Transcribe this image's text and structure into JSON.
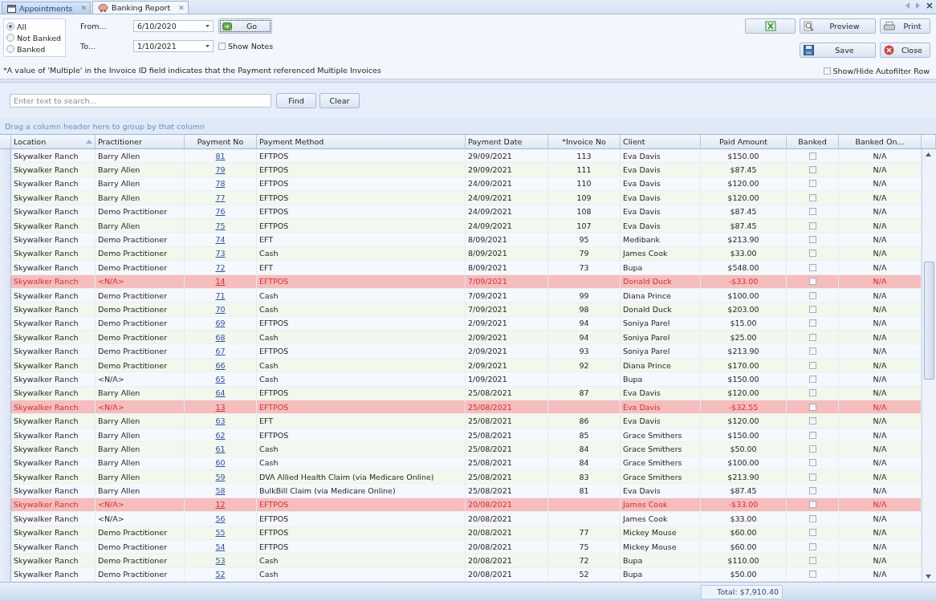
{
  "tabs": [
    {
      "label": "Appointments",
      "selected": false,
      "close": "✕"
    },
    {
      "label": "Banking Report",
      "selected": true,
      "close": "✕"
    }
  ],
  "filter": {
    "options": [
      {
        "label": "All",
        "selected": true
      },
      {
        "label": "Not Banked",
        "selected": false
      },
      {
        "label": "Banked",
        "selected": false
      }
    ],
    "from_label": "From...",
    "from_value": "6/10/2020",
    "to_label": "To...",
    "to_value": "1/10/2021",
    "go_button": "Go",
    "show_notes": {
      "label": "Show Notes",
      "checked": false
    },
    "note": "*A value of 'Multiple' in the Invoice ID field indicates that the Payment referenced Multiple Invoices"
  },
  "actions": {
    "preview": "Preview",
    "print": "Print",
    "save": "Save",
    "close": "Close",
    "autofilter": {
      "label": "Show/Hide Autofilter Row",
      "checked": false
    }
  },
  "search": {
    "placeholder": "Enter text to search...",
    "find": "Find",
    "clear": "Clear"
  },
  "group_hint": "Drag a column header here to group by that column",
  "table": {
    "columns": [
      "Location",
      "Practitioner",
      "Payment No",
      "Payment Method",
      "Payment Date",
      "*Invoice No",
      "Client",
      "Paid Amount",
      "Banked",
      "Banked On..."
    ],
    "rows": [
      {
        "location": "Skywalker Ranch",
        "practitioner": "Barry Allen",
        "payment_no": "81",
        "method": "EFTPOS",
        "date": "29/09/2021",
        "invoice": "113",
        "client": "Eva Davis",
        "amount": "$150.00",
        "banked": false,
        "banked_on": "N/A",
        "flagged": false
      },
      {
        "location": "Skywalker Ranch",
        "practitioner": "Barry Allen",
        "payment_no": "79",
        "method": "EFTPOS",
        "date": "29/09/2021",
        "invoice": "111",
        "client": "Eva Davis",
        "amount": "$87.45",
        "banked": false,
        "banked_on": "N/A",
        "flagged": false
      },
      {
        "location": "Skywalker Ranch",
        "practitioner": "Barry Allen",
        "payment_no": "78",
        "method": "EFTPOS",
        "date": "24/09/2021",
        "invoice": "110",
        "client": "Eva Davis",
        "amount": "$120.00",
        "banked": false,
        "banked_on": "N/A",
        "flagged": false
      },
      {
        "location": "Skywalker Ranch",
        "practitioner": "Barry Allen",
        "payment_no": "77",
        "method": "EFTPOS",
        "date": "24/09/2021",
        "invoice": "109",
        "client": "Eva Davis",
        "amount": "$120.00",
        "banked": false,
        "banked_on": "N/A",
        "flagged": false
      },
      {
        "location": "Skywalker Ranch",
        "practitioner": "Demo Practitioner",
        "payment_no": "76",
        "method": "EFTPOS",
        "date": "24/09/2021",
        "invoice": "108",
        "client": "Eva Davis",
        "amount": "$87.45",
        "banked": false,
        "banked_on": "N/A",
        "flagged": false
      },
      {
        "location": "Skywalker Ranch",
        "practitioner": "Barry Allen",
        "payment_no": "75",
        "method": "EFTPOS",
        "date": "24/09/2021",
        "invoice": "107",
        "client": "Eva Davis",
        "amount": "$87.45",
        "banked": false,
        "banked_on": "N/A",
        "flagged": false
      },
      {
        "location": "Skywalker Ranch",
        "practitioner": "Demo Practitioner",
        "payment_no": "74",
        "method": "EFT",
        "date": "8/09/2021",
        "invoice": "95",
        "client": "Medibank",
        "amount": "$213.90",
        "banked": false,
        "banked_on": "N/A",
        "flagged": false
      },
      {
        "location": "Skywalker Ranch",
        "practitioner": "Demo Practitioner",
        "payment_no": "73",
        "method": "Cash",
        "date": "8/09/2021",
        "invoice": "79",
        "client": "James Cook",
        "amount": "$33.00",
        "banked": false,
        "banked_on": "N/A",
        "flagged": false
      },
      {
        "location": "Skywalker Ranch",
        "practitioner": "Demo Practitioner",
        "payment_no": "72",
        "method": "EFT",
        "date": "8/09/2021",
        "invoice": "73",
        "client": "Bupa",
        "amount": "$548.00",
        "banked": false,
        "banked_on": "N/A",
        "flagged": false
      },
      {
        "location": "Skywalker Ranch",
        "practitioner": "<N/A>",
        "payment_no": "14",
        "method": "EFTPOS",
        "date": "7/09/2021",
        "client": "Donald Duck",
        "amount": "-$33.00",
        "banked": false,
        "banked_on": "N/A",
        "flagged": true
      },
      {
        "location": "Skywalker Ranch",
        "practitioner": "Demo Practitioner",
        "payment_no": "71",
        "method": "Cash",
        "date": "7/09/2021",
        "invoice": "99",
        "client": "Diana Prince",
        "amount": "$100.00",
        "banked": false,
        "banked_on": "N/A",
        "flagged": false
      },
      {
        "location": "Skywalker Ranch",
        "practitioner": "Demo Practitioner",
        "payment_no": "70",
        "method": "Cash",
        "date": "7/09/2021",
        "invoice": "98",
        "client": "Donald Duck",
        "amount": "$203.00",
        "banked": false,
        "banked_on": "N/A",
        "flagged": false
      },
      {
        "location": "Skywalker Ranch",
        "practitioner": "Demo Practitioner",
        "payment_no": "69",
        "method": "EFTPOS",
        "date": "2/09/2021",
        "invoice": "94",
        "client": "Soniya Parel",
        "amount": "$15.00",
        "banked": false,
        "banked_on": "N/A",
        "flagged": false
      },
      {
        "location": "Skywalker Ranch",
        "practitioner": "Demo Practitioner",
        "payment_no": "68",
        "method": "Cash",
        "date": "2/09/2021",
        "invoice": "94",
        "client": "Soniya Parel",
        "amount": "$25.00",
        "banked": false,
        "banked_on": "N/A",
        "flagged": false
      },
      {
        "location": "Skywalker Ranch",
        "practitioner": "Demo Practitioner",
        "payment_no": "67",
        "method": "EFTPOS",
        "date": "2/09/2021",
        "invoice": "93",
        "client": "Soniya Parel",
        "amount": "$213.90",
        "banked": false,
        "banked_on": "N/A",
        "flagged": false
      },
      {
        "location": "Skywalker Ranch",
        "practitioner": "Demo Practitioner",
        "payment_no": "66",
        "method": "Cash",
        "date": "2/09/2021",
        "invoice": "92",
        "client": "Diana Prince",
        "amount": "$170.00",
        "banked": false,
        "banked_on": "N/A",
        "flagged": false
      },
      {
        "location": "Skywalker Ranch",
        "practitioner": "<N/A>",
        "payment_no": "65",
        "method": "Cash",
        "date": "1/09/2021",
        "client": "Bupa",
        "amount": "$150.00",
        "banked": false,
        "banked_on": "N/A",
        "flagged": false
      },
      {
        "location": "Skywalker Ranch",
        "practitioner": "Barry Allen",
        "payment_no": "64",
        "method": "EFTPOS",
        "date": "25/08/2021",
        "invoice": "87",
        "client": "Eva Davis",
        "amount": "$120.00",
        "banked": false,
        "banked_on": "N/A",
        "flagged": false
      },
      {
        "location": "Skywalker Ranch",
        "practitioner": "<N/A>",
        "payment_no": "13",
        "method": "EFTPOS",
        "date": "25/08/2021",
        "client": "Eva Davis",
        "amount": "-$32.55",
        "banked": false,
        "banked_on": "N/A",
        "flagged": true
      },
      {
        "location": "Skywalker Ranch",
        "practitioner": "Barry Allen",
        "payment_no": "63",
        "method": "EFT",
        "date": "25/08/2021",
        "invoice": "86",
        "client": "Eva Davis",
        "amount": "$120.00",
        "banked": false,
        "banked_on": "N/A",
        "flagged": false
      },
      {
        "location": "Skywalker Ranch",
        "practitioner": "Barry Allen",
        "payment_no": "62",
        "method": "EFTPOS",
        "date": "25/08/2021",
        "invoice": "85",
        "client": "Grace Smithers",
        "amount": "$150.00",
        "banked": false,
        "banked_on": "N/A",
        "flagged": false
      },
      {
        "location": "Skywalker Ranch",
        "practitioner": "Barry Allen",
        "payment_no": "61",
        "method": "Cash",
        "date": "25/08/2021",
        "invoice": "84",
        "client": "Grace Smithers",
        "amount": "$50.00",
        "banked": false,
        "banked_on": "N/A",
        "flagged": false
      },
      {
        "location": "Skywalker Ranch",
        "practitioner": "Barry Allen",
        "payment_no": "60",
        "method": "Cash",
        "date": "25/08/2021",
        "invoice": "84",
        "client": "Grace Smithers",
        "amount": "$100.00",
        "banked": false,
        "banked_on": "N/A",
        "flagged": false
      },
      {
        "location": "Skywalker Ranch",
        "practitioner": "Barry Allen",
        "payment_no": "59",
        "method": "DVA Allied Health Claim (via Medicare Online)",
        "date": "25/08/2021",
        "invoice": "83",
        "client": "Grace Smithers",
        "amount": "$213.90",
        "banked": false,
        "banked_on": "N/A",
        "flagged": false
      },
      {
        "location": "Skywalker Ranch",
        "practitioner": "Barry Allen",
        "payment_no": "58",
        "method": "BulkBill Claim (via Medicare Online)",
        "date": "25/08/2021",
        "invoice": "81",
        "client": "Eva Davis",
        "amount": "$87.45",
        "banked": false,
        "banked_on": "N/A",
        "flagged": false
      },
      {
        "location": "Skywalker Ranch",
        "practitioner": "<N/A>",
        "payment_no": "12",
        "method": "EFTPOS",
        "date": "20/08/2021",
        "client": "James Cook",
        "amount": "-$33.00",
        "banked": false,
        "banked_on": "N/A",
        "flagged": true
      },
      {
        "location": "Skywalker Ranch",
        "practitioner": "<N/A>",
        "payment_no": "56",
        "method": "EFTPOS",
        "date": "20/08/2021",
        "client": "James Cook",
        "amount": "$33.00",
        "banked": false,
        "banked_on": "N/A",
        "flagged": false
      },
      {
        "location": "Skywalker Ranch",
        "practitioner": "Demo Practitioner",
        "payment_no": "55",
        "method": "EFTPOS",
        "date": "20/08/2021",
        "invoice": "77",
        "client": "Mickey Mouse",
        "amount": "$60.00",
        "banked": false,
        "banked_on": "N/A",
        "flagged": false
      },
      {
        "location": "Skywalker Ranch",
        "practitioner": "Demo Practitioner",
        "payment_no": "54",
        "method": "EFTPOS",
        "date": "20/08/2021",
        "invoice": "75",
        "client": "Mickey Mouse",
        "amount": "$60.00",
        "banked": false,
        "banked_on": "N/A",
        "flagged": false
      },
      {
        "location": "Skywalker Ranch",
        "practitioner": "Demo Practitioner",
        "payment_no": "53",
        "method": "Cash",
        "date": "20/08/2021",
        "invoice": "72",
        "client": "Bupa",
        "amount": "$110.00",
        "banked": false,
        "banked_on": "N/A",
        "flagged": false
      },
      {
        "location": "Skywalker Ranch",
        "practitioner": "Demo Practitioner",
        "payment_no": "52",
        "method": "Cash",
        "date": "20/08/2021",
        "invoice": "52",
        "client": "Bupa",
        "amount": "$50.00",
        "banked": false,
        "banked_on": "N/A",
        "flagged": false
      }
    ],
    "total": "Total: $7,910.40"
  }
}
